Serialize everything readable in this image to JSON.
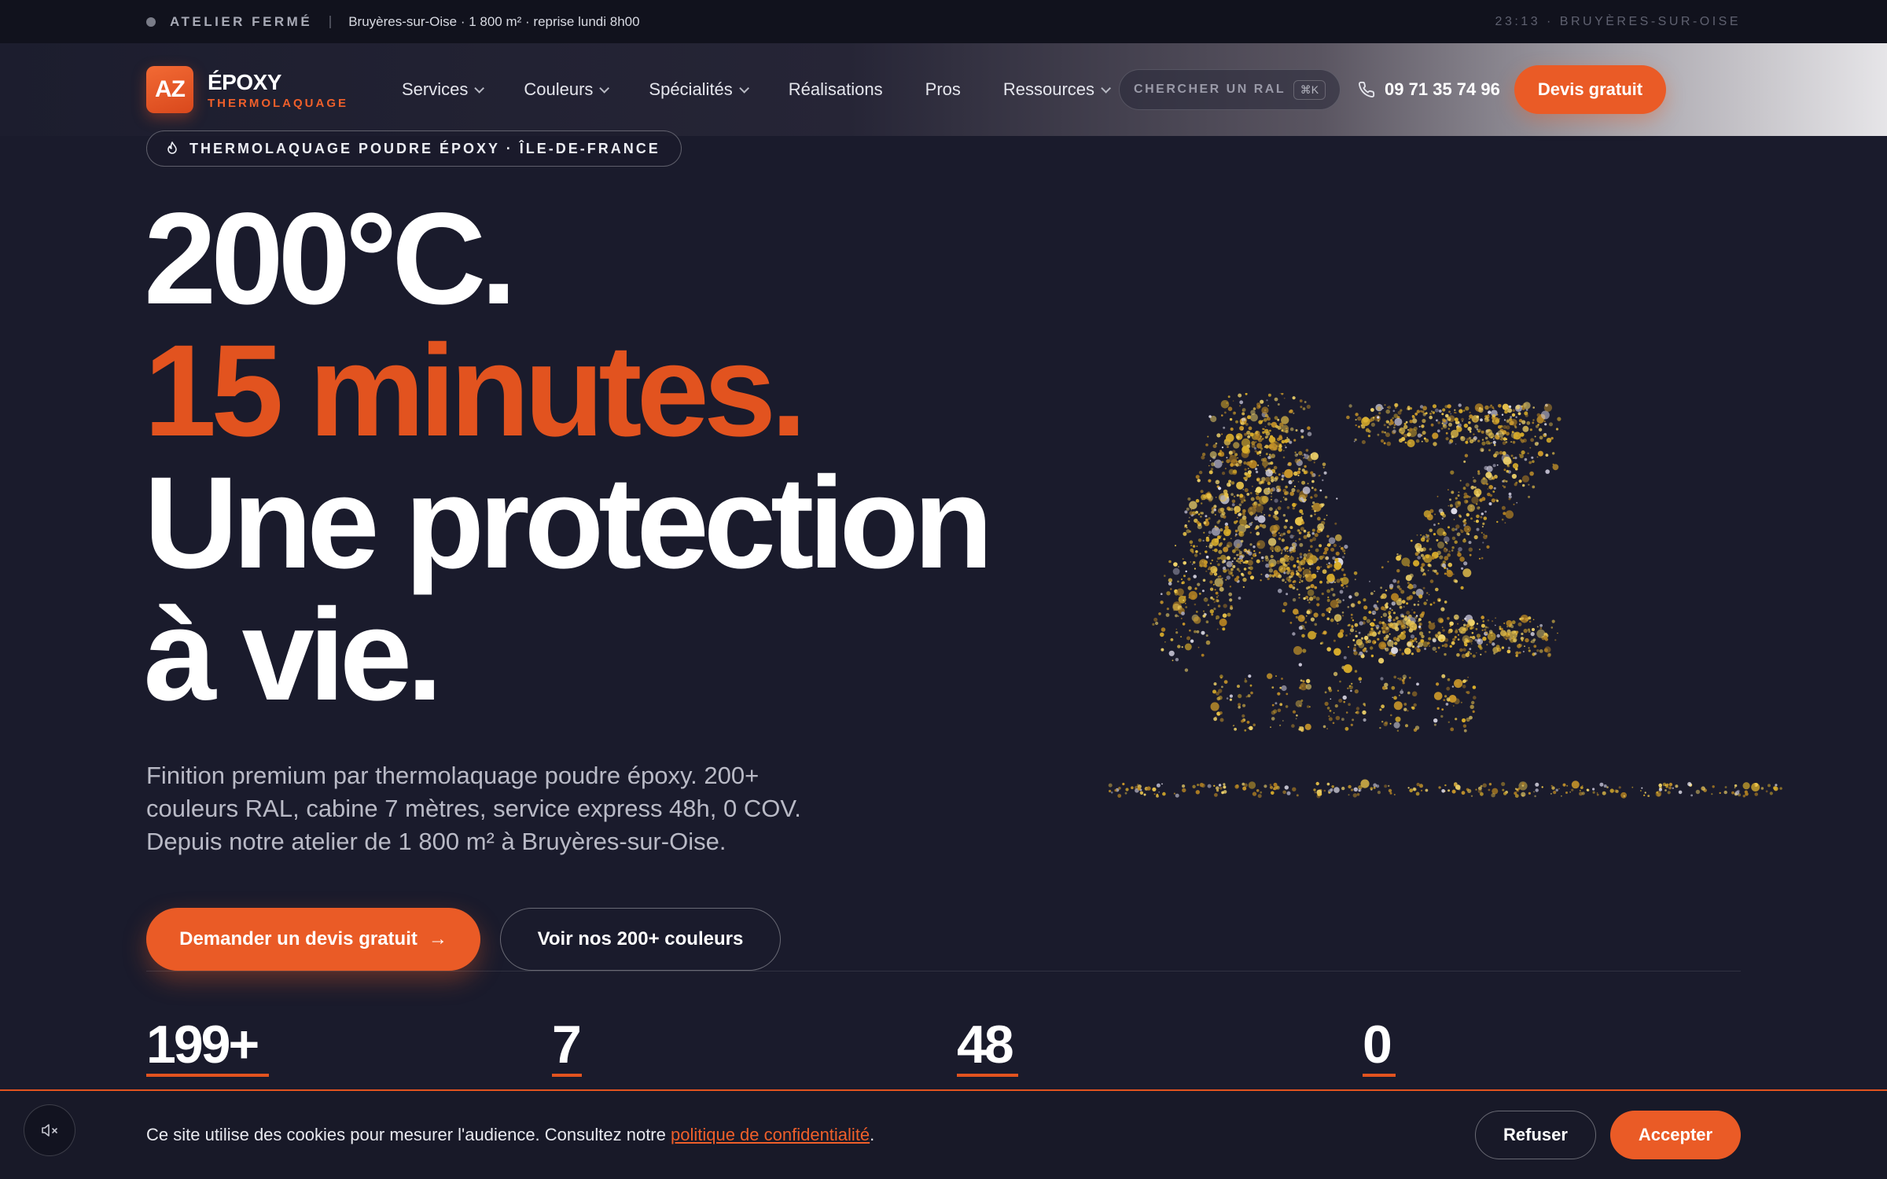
{
  "topbar": {
    "status": "ATELIER FERMÉ",
    "info": "Bruyères-sur-Oise · 1 800 m² · reprise lundi 8h00",
    "clock": "23:13 · BRUYÈRES-SUR-OISE"
  },
  "header": {
    "logo_mark": "AZ",
    "logo_name": "ÉPOXY",
    "logo_sub": "THERMOLAQUAGE",
    "nav": [
      {
        "label": "Services",
        "dropdown": true
      },
      {
        "label": "Couleurs",
        "dropdown": true
      },
      {
        "label": "Spécialités",
        "dropdown": true
      },
      {
        "label": "Réalisations",
        "dropdown": false
      },
      {
        "label": "Pros",
        "dropdown": false
      },
      {
        "label": "Ressources",
        "dropdown": true
      }
    ],
    "search_placeholder": "CHERCHER UN RAL",
    "search_shortcut": "⌘K",
    "phone": "09 71 35 74 96",
    "cta": "Devis gratuit"
  },
  "hero": {
    "tag": "THERMOLAQUAGE POUDRE ÉPOXY · ÎLE-DE-FRANCE",
    "line1": "200°C.",
    "line2": "15 minutes.",
    "line3": "Une protection",
    "line4": "à vie.",
    "description": "Finition premium par thermolaquage poudre époxy. 200+ couleurs RAL, cabine 7 mètres, service express 48h, 0 COV. Depuis notre atelier de 1 800 m² à Bruyères-sur-Oise.",
    "cta_primary": "Demander un devis gratuit",
    "cta_secondary": "Voir nos 200+ couleurs"
  },
  "stats": [
    {
      "value": "199+"
    },
    {
      "value": "7"
    },
    {
      "value": "48"
    },
    {
      "value": "0"
    }
  ],
  "cookie": {
    "text": "Ce site utilise des cookies pour mesurer l'audience. Consultez notre ",
    "link": "politique de confidentialité",
    "end": ".",
    "refuse": "Refuser",
    "accept": "Accepter"
  },
  "icons": {
    "status_dot": "status-dot-icon",
    "chevron": "chevron-down-icon",
    "phone": "phone-icon",
    "flame": "flame-icon",
    "arrow": "arrow-right-icon",
    "mute": "speaker-mute-icon"
  },
  "colors": {
    "background": "#1a1b2c",
    "accent": "#ea5b26",
    "accent_text": "#e2531f",
    "particles": "#d4a72c"
  }
}
